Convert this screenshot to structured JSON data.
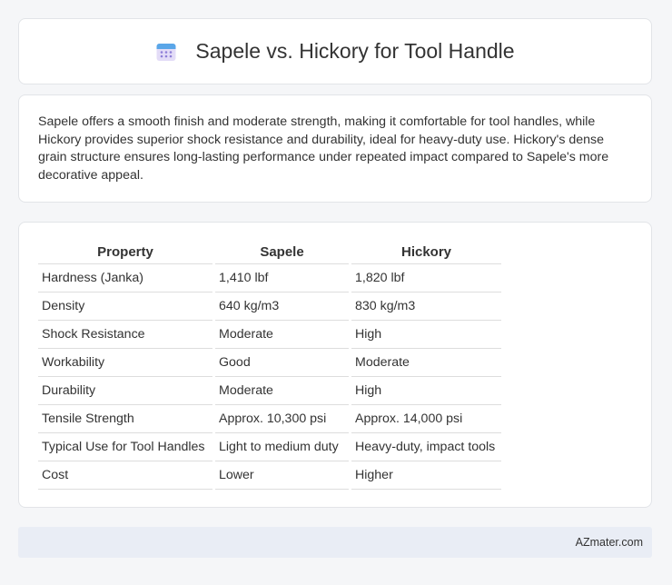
{
  "header": {
    "title": "Sapele vs. Hickory for Tool Handle",
    "icon": "calendar-icon"
  },
  "description": "Sapele offers a smooth finish and moderate strength, making it comfortable for tool handles, while Hickory provides superior shock resistance and durability, ideal for heavy-duty use. Hickory's dense grain structure ensures long-lasting performance under repeated impact compared to Sapele's more decorative appeal.",
  "table": {
    "headers": [
      "Property",
      "Sapele",
      "Hickory"
    ],
    "rows": [
      [
        "Hardness (Janka)",
        "1,410 lbf",
        "1,820 lbf"
      ],
      [
        "Density",
        "640 kg/m3",
        "830 kg/m3"
      ],
      [
        "Shock Resistance",
        "Moderate",
        "High"
      ],
      [
        "Workability",
        "Good",
        "Moderate"
      ],
      [
        "Durability",
        "Moderate",
        "High"
      ],
      [
        "Tensile Strength",
        "Approx. 10,300 psi",
        "Approx. 14,000 psi"
      ],
      [
        "Typical Use for Tool Handles",
        "Light to medium duty",
        "Heavy-duty, impact tools"
      ],
      [
        "Cost",
        "Lower",
        "Higher"
      ]
    ]
  },
  "footer": {
    "source": "AZmater.com"
  },
  "colors": {
    "accent": "#7b7fd4",
    "icon_top": "#5aa6e8",
    "background": "#f5f6f8",
    "footer_bg": "#e9edf5"
  }
}
